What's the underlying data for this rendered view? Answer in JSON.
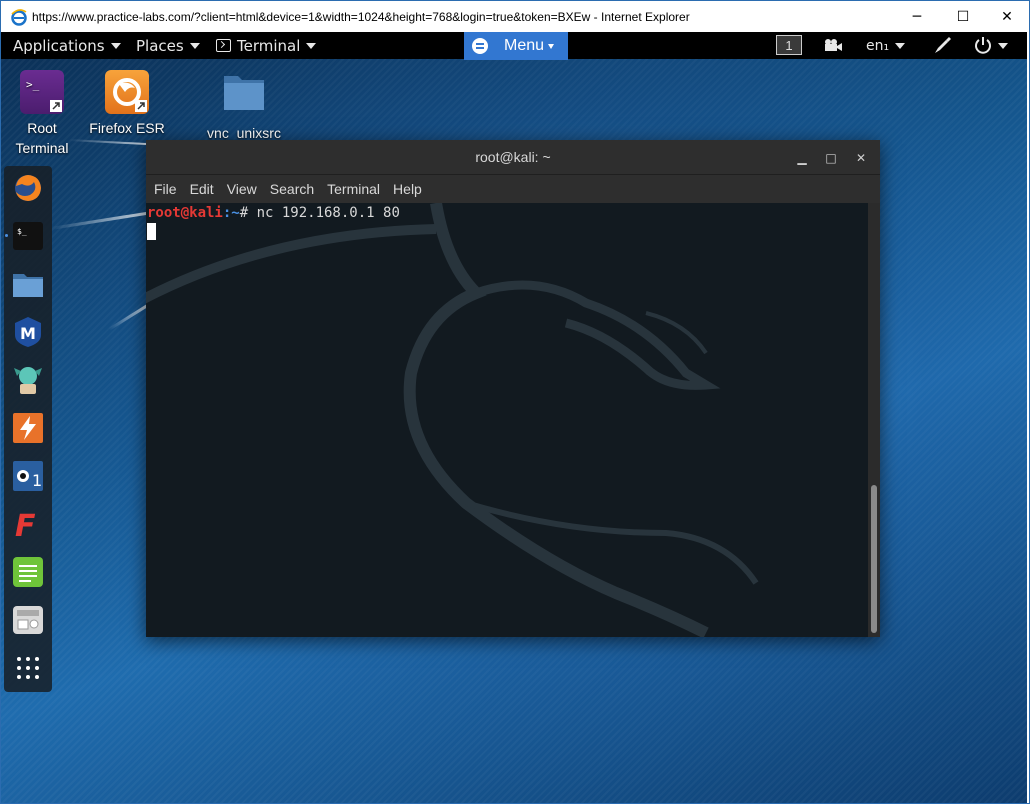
{
  "browser": {
    "title": "https://www.practice-labs.com/?client=html&device=1&width=1024&height=768&login=true&token=BXEw - Internet Explorer",
    "minimize": "─",
    "maximize": "☐",
    "close": "✕"
  },
  "topbar": {
    "applications": "Applications",
    "places": "Places",
    "terminal": "Terminal",
    "menu": "Menu",
    "workspace": "1",
    "language": "en₁"
  },
  "desktop": {
    "icons": [
      {
        "label_line1": "Root",
        "label_line2": "Terminal",
        "icon": "root-terminal-icon"
      },
      {
        "label_line1": "Firefox ESR",
        "icon": "firefox-icon"
      },
      {
        "label_line1": "vnc_unixsrc",
        "icon": "folder-icon"
      }
    ]
  },
  "dock": {
    "items": [
      "firefox-icon",
      "terminal-icon",
      "files-icon",
      "metasploit-icon",
      "armitage-icon",
      "burpsuite-icon",
      "beef-icon",
      "faraday-icon",
      "text-editor-icon",
      "settings-icon",
      "show-apps-icon"
    ]
  },
  "terminal_window": {
    "title": "root@kali: ~",
    "menu": [
      "File",
      "Edit",
      "View",
      "Search",
      "Terminal",
      "Help"
    ],
    "prompt_user": "root@kali",
    "prompt_path": ":~",
    "prompt_symbol": "# ",
    "command": "nc 192.168.0.1 80",
    "min": "▁",
    "max": "□",
    "close": "✕"
  },
  "colors": {
    "prompt_user": "#e53935",
    "prompt_path": "#4a90e2",
    "menu_button": "#3277d1"
  }
}
